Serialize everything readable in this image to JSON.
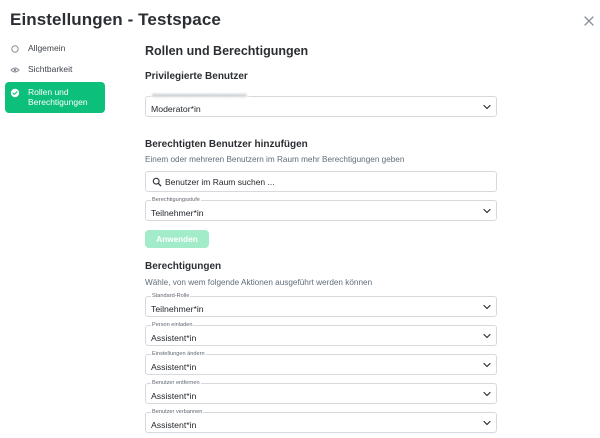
{
  "window": {
    "title": "Einstellungen - Testspace"
  },
  "nav": {
    "items": [
      {
        "label": "Allgemein",
        "icon": "circle-icon"
      },
      {
        "label": "Sichtbarkeit",
        "icon": "eye-icon"
      },
      {
        "label": "Rollen und Berechtigungen",
        "icon": "check-circle-icon",
        "active": true
      }
    ]
  },
  "main": {
    "title": "Rollen und Berechtigungen",
    "privileged": {
      "heading": "Privilegierte Benutzer",
      "select_value": "Moderator*in"
    },
    "add_users": {
      "heading": "Berechtigten Benutzer hinzufügen",
      "description": "Einem oder mehreren Benutzern im Raum mehr Berechtigungen geben",
      "search_placeholder": "Benutzer im Raum suchen ...",
      "level_label": "Berechtigungsstufe",
      "level_value": "Teilnehmer*in",
      "apply_label": "Anwenden"
    },
    "permissions": {
      "heading": "Berechtigungen",
      "description": "Wähle, von wem folgende Aktionen ausgeführt werden können",
      "rows": [
        {
          "label": "Standard-Rolle",
          "value": "Teilnehmer*in"
        },
        {
          "label": "Person einladen",
          "value": "Assistent*in"
        },
        {
          "label": "Einstellungen ändern",
          "value": "Assistent*in"
        },
        {
          "label": "Benutzer entfernen",
          "value": "Assistent*in"
        },
        {
          "label": "Benutzer verbannen",
          "value": "Assistent*in"
        }
      ]
    }
  },
  "colors": {
    "accent": "#0cbf7a",
    "button_disabled": "#a3ecc9"
  }
}
